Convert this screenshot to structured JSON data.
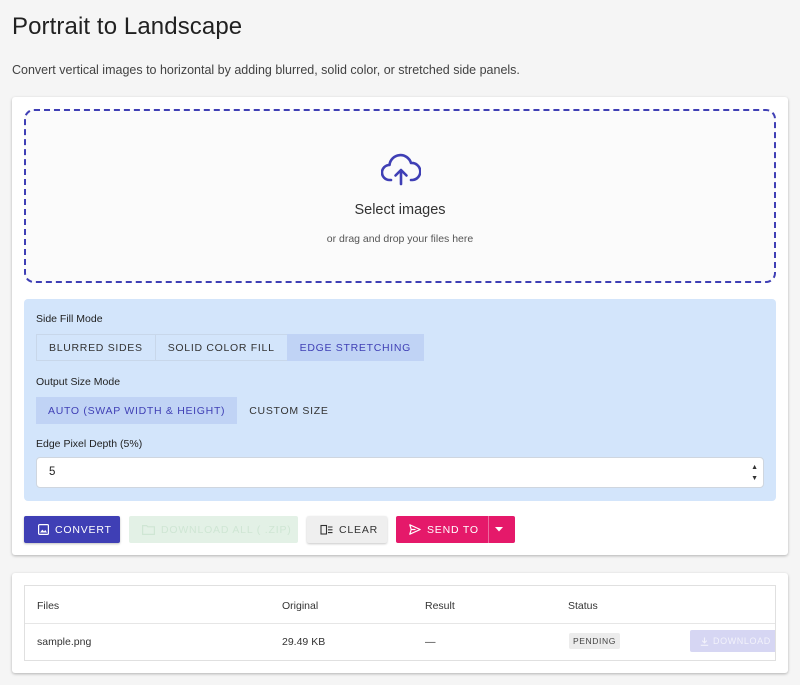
{
  "page": {
    "title": "Portrait to Landscape",
    "description": "Convert vertical images to horizontal by adding blurred, solid color, or stretched side panels."
  },
  "dropzone": {
    "title": "Select images",
    "subtitle": "or drag and drop your files here",
    "icon": "cloud-upload-icon"
  },
  "options": {
    "side_fill_label": "Side Fill Mode",
    "side_fill_modes": [
      "Blurred Sides",
      "Solid Color Fill",
      "Edge Stretching"
    ],
    "side_fill_selected": "Edge Stretching",
    "output_size_label": "Output Size Mode",
    "output_size_modes": [
      "Auto (Swap Width & Height)",
      "Custom Size"
    ],
    "output_size_selected": "Auto (Swap Width & Height)",
    "edge_depth_label": "Edge Pixel Depth (5%)",
    "edge_depth_value": "5"
  },
  "actions": {
    "convert": "Convert",
    "download_all": "Download All ( .zip)",
    "clear": "Clear",
    "send_to": "Send To"
  },
  "files_table": {
    "columns": [
      "Files",
      "Original",
      "Result",
      "Status"
    ],
    "rows": [
      {
        "file": "sample.png",
        "original": "29.49 KB",
        "result": "—",
        "status": "Pending",
        "download": "Download"
      }
    ]
  },
  "colors": {
    "primary": "#3f3fb5",
    "accent": "#e5196a",
    "options_bg": "#d3e5fb",
    "success_disabled": "#e3f1e6"
  }
}
